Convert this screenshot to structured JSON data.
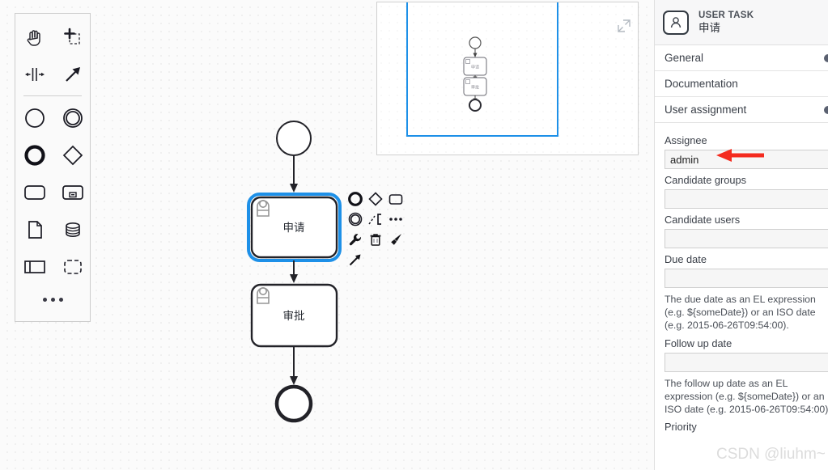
{
  "palette": {
    "tools": [
      {
        "name": "hand-tool",
        "label": "Activate the hand tool"
      },
      {
        "name": "lasso-tool",
        "label": "Activate the lasso tool"
      },
      {
        "name": "space-tool",
        "label": "Activate the create/remove space tool"
      },
      {
        "name": "connect-tool",
        "label": "Activate the global connect tool"
      }
    ],
    "elements": [
      {
        "name": "start-event",
        "label": "Create StartEvent"
      },
      {
        "name": "intermediate-event",
        "label": "Create Intermediate/Boundary Event"
      },
      {
        "name": "end-event",
        "label": "Create EndEvent"
      },
      {
        "name": "exclusive-gateway",
        "label": "Create Gateway"
      },
      {
        "name": "task",
        "label": "Create Task"
      },
      {
        "name": "subprocess-expanded",
        "label": "Create expanded SubProcess"
      },
      {
        "name": "data-object",
        "label": "Create DataObjectReference"
      },
      {
        "name": "data-store",
        "label": "Create DataStoreReference"
      },
      {
        "name": "participant",
        "label": "Create Pool/Participant"
      },
      {
        "name": "group",
        "label": "Create Group"
      }
    ],
    "more_label": "..."
  },
  "minimap": {
    "toggle_label": "Toggle minimap"
  },
  "diagram": {
    "nodes": [
      {
        "id": "start",
        "type": "start-event",
        "label": ""
      },
      {
        "id": "task1",
        "type": "user-task",
        "label": "申请",
        "selected": true
      },
      {
        "id": "task2",
        "type": "user-task",
        "label": "审批",
        "selected": false
      },
      {
        "id": "end",
        "type": "end-event",
        "label": ""
      }
    ],
    "selection_color": "#1d90e8"
  },
  "context_pad": {
    "actions": [
      {
        "name": "append-end-event",
        "label": "Append EndEvent"
      },
      {
        "name": "append-gateway",
        "label": "Append Gateway"
      },
      {
        "name": "append-task",
        "label": "Append Task"
      },
      {
        "name": "append-intermediate-event",
        "label": "Append Intermediate/Boundary Event"
      },
      {
        "name": "append-text-annotation",
        "label": "Append TextAnnotation"
      },
      {
        "name": "more-options",
        "label": "..."
      },
      {
        "name": "change-type",
        "label": "Change type"
      },
      {
        "name": "delete",
        "label": "Remove"
      },
      {
        "name": "set-color",
        "label": "Set color"
      },
      {
        "name": "connect",
        "label": "Connect using Sequence/MessageFlow"
      }
    ]
  },
  "properties": {
    "header": {
      "type": "USER TASK",
      "name": "申请",
      "icon": "user-task-icon"
    },
    "groups": [
      {
        "id": "general",
        "label": "General",
        "has_marker": true
      },
      {
        "id": "documentation",
        "label": "Documentation",
        "has_marker": false
      },
      {
        "id": "user-assignment",
        "label": "User assignment",
        "has_marker": true
      }
    ],
    "fields": [
      {
        "id": "assignee",
        "label": "Assignee",
        "value": "admin",
        "placeholder": ""
      },
      {
        "id": "candidate-groups",
        "label": "Candidate groups",
        "value": "",
        "placeholder": ""
      },
      {
        "id": "candidate-users",
        "label": "Candidate users",
        "value": "",
        "placeholder": ""
      },
      {
        "id": "due-date",
        "label": "Due date",
        "value": "",
        "placeholder": "",
        "help": "The due date as an EL expression (e.g. ${someDate}) or an ISO date (e.g. 2015-06-26T09:54:00)."
      },
      {
        "id": "follow-up-date",
        "label": "Follow up date",
        "value": "",
        "placeholder": "",
        "help": "The follow up date as an EL expression (e.g. ${someDate}) or an ISO date (e.g. 2015-06-26T09:54:00)."
      },
      {
        "id": "priority",
        "label": "Priority",
        "value": "",
        "placeholder": ""
      }
    ]
  },
  "annotation": {
    "arrow_color": "#f42b1f",
    "points_to": "assignee"
  },
  "watermark": {
    "text": "CSDN @liuhm~"
  }
}
